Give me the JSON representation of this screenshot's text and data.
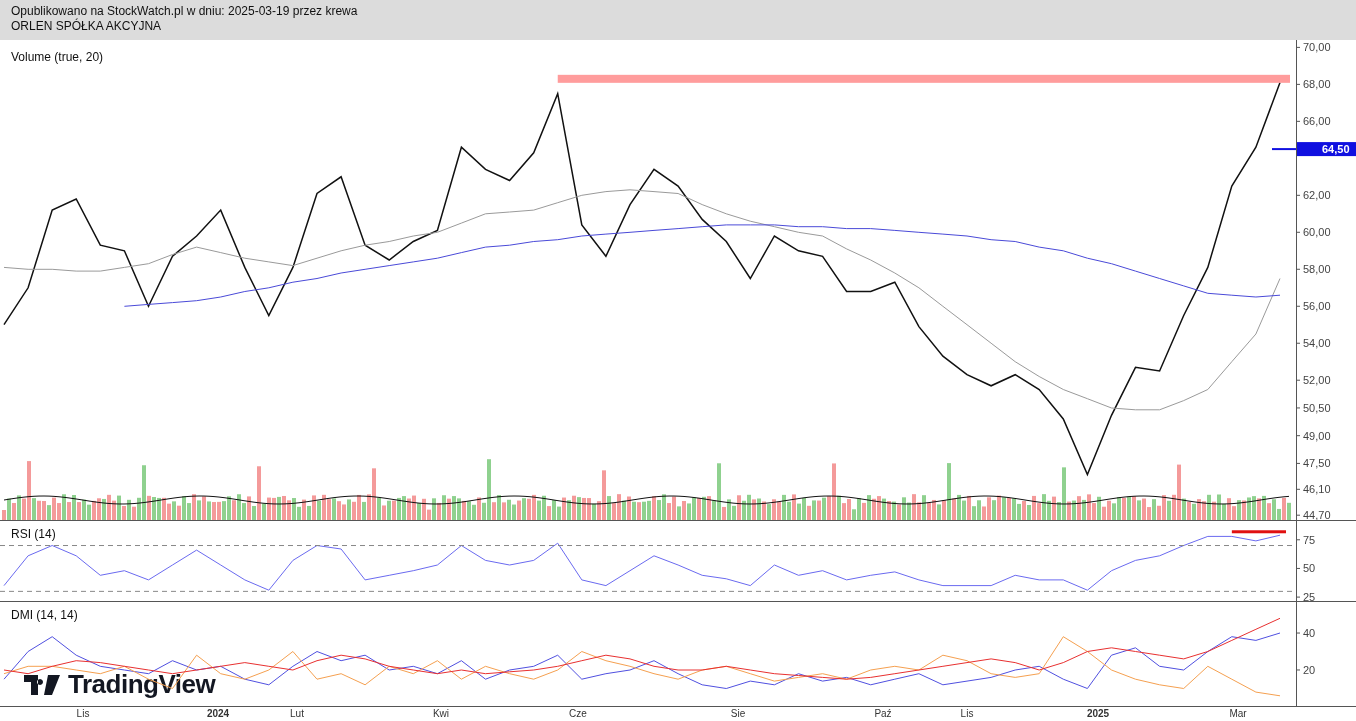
{
  "header": {
    "published": "Opublikowano na StockWatch.pl w dniu: 2025-03-19 przez krewa",
    "instrument": "ORLEN SPÓŁKA AKCYJNA"
  },
  "price_pane": {
    "volume_label": "Volume (true, 20)",
    "last_price_label": "64,50",
    "chart_data": {
      "type": "line",
      "ylim": [
        44.44,
        70.4
      ],
      "yticks": [
        {
          "value": 70,
          "label": "70,00"
        },
        {
          "value": 68,
          "label": "68,00"
        },
        {
          "value": 66,
          "label": "66,00"
        },
        {
          "value": 62,
          "label": "62,00"
        },
        {
          "value": 60,
          "label": "60,00"
        },
        {
          "value": 58,
          "label": "58,00"
        },
        {
          "value": 56,
          "label": "56,00"
        },
        {
          "value": 54,
          "label": "54,00"
        },
        {
          "value": 52,
          "label": "52,00"
        },
        {
          "value": 50.5,
          "label": "50,50"
        },
        {
          "value": 49,
          "label": "49,00"
        },
        {
          "value": 47.5,
          "label": "47,50"
        },
        {
          "value": 46.1,
          "label": "46,10"
        },
        {
          "value": 44.7,
          "label": "44,70"
        }
      ],
      "series": [
        {
          "color": "#111111",
          "values": [
            55,
            57,
            61.2,
            61.8,
            59.3,
            59,
            56,
            58.7,
            59.8,
            61.2,
            58.1,
            55.5,
            58.1,
            62.1,
            63,
            59.3,
            58.5,
            59.5,
            60.1,
            64.6,
            63.4,
            62.8,
            64.3,
            67.5,
            60.4,
            58.7,
            61.5,
            63.4,
            62.5,
            60.7,
            59.5,
            57.5,
            59.8,
            59,
            58.7,
            56.8,
            56.8,
            57.3,
            54.9,
            53.3,
            52.3,
            51.7,
            52.3,
            51.5,
            49.9,
            46.9,
            50.1,
            52.7,
            52.5,
            55.5,
            58.1,
            62.5,
            64.6,
            68.1
          ]
        },
        {
          "color": "#9a9a9a",
          "values": [
            58.1,
            58,
            58,
            57.9,
            57.9,
            58.1,
            58.3,
            58.8,
            59.2,
            58.9,
            58.6,
            58.4,
            58.2,
            58.6,
            59,
            59.3,
            59.5,
            59.8,
            60,
            60.5,
            61,
            61.1,
            61.2,
            61.6,
            62,
            62.2,
            62.3,
            62.2,
            62.1,
            61.5,
            61,
            60.6,
            60.3,
            60,
            59.8,
            59.1,
            58.5,
            57.8,
            57,
            56,
            55,
            54,
            53,
            52.2,
            51.5,
            51,
            50.5,
            50.4,
            50.4,
            50.9,
            51.5,
            53,
            54.5,
            57.5
          ]
        },
        {
          "color": "#4a4ad8",
          "values": [
            null,
            null,
            null,
            null,
            null,
            56,
            56.1,
            56.2,
            56.3,
            56.5,
            56.8,
            57,
            57.3,
            57.5,
            57.8,
            58,
            58.2,
            58.4,
            58.6,
            58.9,
            59.2,
            59.3,
            59.5,
            59.6,
            59.8,
            59.9,
            60,
            60.1,
            60.2,
            60.3,
            60.4,
            60.4,
            60.4,
            60.3,
            60.3,
            60.2,
            60.2,
            60.1,
            60,
            59.9,
            59.8,
            59.6,
            59.5,
            59.2,
            59,
            58.6,
            58.3,
            57.9,
            57.5,
            57.1,
            56.7,
            56.6,
            56.5,
            56.6
          ]
        }
      ]
    }
  },
  "rsi_pane": {
    "title": "RSI (14)",
    "chart_data": {
      "type": "line",
      "ylim": [
        21.6,
        91.4
      ],
      "yticks": [
        75,
        50,
        25
      ],
      "series": [
        {
          "color": "#6a6af0",
          "values": [
            35,
            61,
            70,
            61,
            44,
            48,
            40,
            53,
            66,
            53,
            40,
            31,
            57,
            70,
            67,
            40,
            44,
            48,
            53,
            70,
            57,
            53,
            57,
            72,
            40,
            35,
            48,
            61,
            53,
            44,
            41,
            35,
            53,
            44,
            48,
            40,
            44,
            47,
            40,
            35,
            35,
            35,
            44,
            40,
            40,
            31,
            48,
            57,
            61,
            70,
            78,
            78,
            74,
            79
          ]
        }
      ]
    }
  },
  "dmi_pane": {
    "title": "DMI (14, 14)",
    "chart_data": {
      "type": "line",
      "ylim": [
        0.5,
        56.8
      ],
      "yticks": [
        40,
        20
      ],
      "series": [
        {
          "color": "#5050e0",
          "values": [
            15,
            30,
            38,
            28,
            22,
            20,
            18,
            25,
            20,
            22,
            15,
            12,
            22,
            30,
            25,
            28,
            20,
            22,
            18,
            25,
            15,
            20,
            22,
            28,
            15,
            18,
            20,
            25,
            18,
            12,
            10,
            14,
            12,
            18,
            14,
            16,
            12,
            15,
            18,
            12,
            14,
            16,
            20,
            22,
            15,
            10,
            28,
            32,
            22,
            20,
            30,
            38,
            36,
            40
          ]
        },
        {
          "color": "#f5a050",
          "values": [
            18,
            22,
            22,
            20,
            18,
            22,
            15,
            10,
            28,
            18,
            15,
            20,
            30,
            15,
            18,
            12,
            22,
            18,
            25,
            15,
            22,
            18,
            15,
            20,
            30,
            25,
            22,
            18,
            15,
            20,
            22,
            18,
            14,
            16,
            18,
            15,
            20,
            22,
            20,
            28,
            25,
            18,
            16,
            18,
            38,
            30,
            20,
            15,
            12,
            10,
            22,
            15,
            8,
            6
          ]
        },
        {
          "color": "#e83030",
          "values": [
            20,
            18,
            22,
            25,
            24,
            22,
            20,
            18,
            20,
            22,
            24,
            22,
            20,
            25,
            28,
            26,
            22,
            20,
            18,
            20,
            18,
            19,
            20,
            22,
            25,
            28,
            26,
            22,
            20,
            20,
            22,
            20,
            18,
            17,
            16,
            15,
            16,
            18,
            20,
            22,
            24,
            26,
            24,
            20,
            24,
            30,
            32,
            30,
            28,
            26,
            30,
            36,
            42,
            48
          ]
        }
      ]
    }
  },
  "logo": "TradingView",
  "time_axis": [
    {
      "label": "Lis",
      "year": false
    },
    {
      "label": "2024",
      "year": true
    },
    {
      "label": "Lut",
      "year": false
    },
    {
      "label": "Kwi",
      "year": false
    },
    {
      "label": "Cze",
      "year": false
    },
    {
      "label": "Sie",
      "year": false
    },
    {
      "label": "Paź",
      "year": false
    },
    {
      "label": "Lis",
      "year": false
    },
    {
      "label": "2025",
      "year": true
    },
    {
      "label": "Mar",
      "year": false
    }
  ]
}
